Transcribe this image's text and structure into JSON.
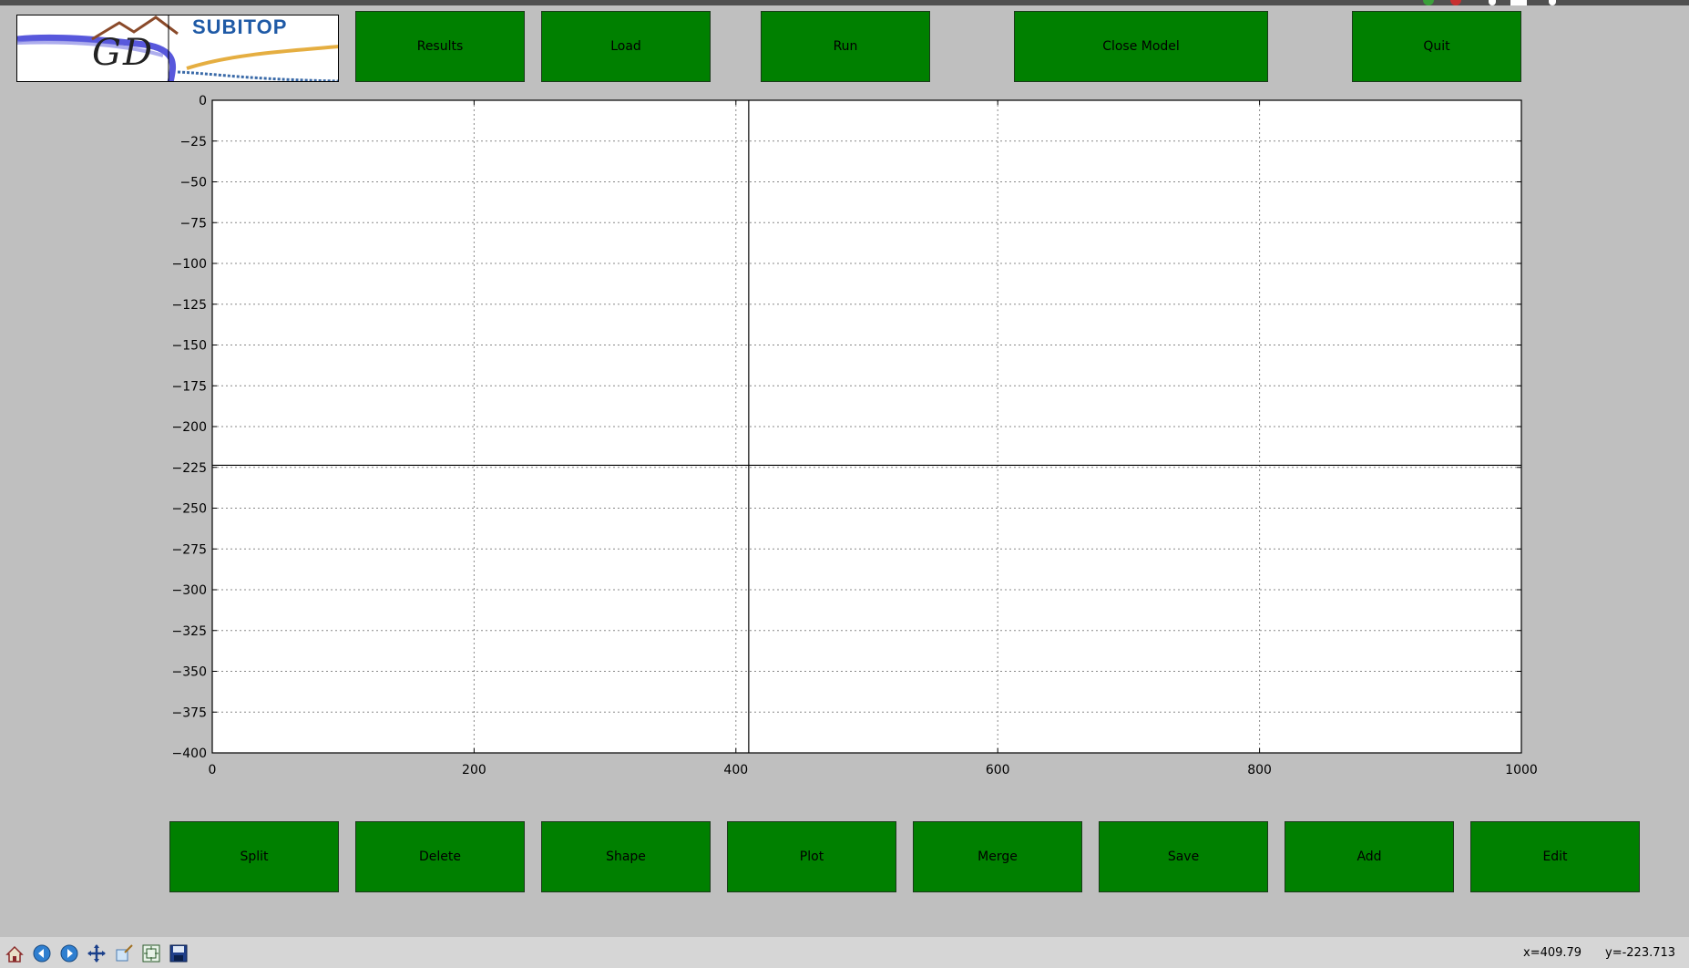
{
  "header": {
    "logo_text_left": "GD",
    "logo_text_right": "SUBITOP",
    "buttons": {
      "results": "Results",
      "load": "Load",
      "run": "Run",
      "close_model": "Close Model",
      "quit": "Quit"
    }
  },
  "footer_buttons": {
    "split": "Split",
    "delete": "Delete",
    "shape": "Shape",
    "plot": "Plot",
    "merge": "Merge",
    "save": "Save",
    "add": "Add",
    "edit": "Edit"
  },
  "toolbar": {
    "icons": [
      "home-icon",
      "back-icon",
      "forward-icon",
      "pan-icon",
      "zoom-icon",
      "configure-subplots-icon",
      "save-figure-icon"
    ]
  },
  "status": {
    "x_readout": "x=409.79",
    "y_readout": "y=-223.713"
  },
  "colors": {
    "button_green": "#008000",
    "background": "#bfbfbf"
  },
  "chart_data": {
    "type": "line",
    "title": "",
    "xlabel": "",
    "ylabel": "",
    "xlim": [
      0,
      1000
    ],
    "ylim": [
      -400,
      0
    ],
    "xticks": [
      0,
      200,
      400,
      600,
      800,
      1000
    ],
    "yticks": [
      0,
      -25,
      -50,
      -75,
      -100,
      -125,
      -150,
      -175,
      -200,
      -225,
      -250,
      -275,
      -300,
      -325,
      -350,
      -375,
      -400
    ],
    "xtick_labels": [
      "0",
      "200",
      "400",
      "600",
      "800",
      "1000"
    ],
    "ytick_labels": [
      "0",
      "−25",
      "−50",
      "−75",
      "−100",
      "−125",
      "−150",
      "−175",
      "−200",
      "−225",
      "−250",
      "−275",
      "−300",
      "−325",
      "−350",
      "−375",
      "−400"
    ],
    "grid": true,
    "crosshair": {
      "x": 409.79,
      "y": -223.713
    },
    "series": []
  }
}
